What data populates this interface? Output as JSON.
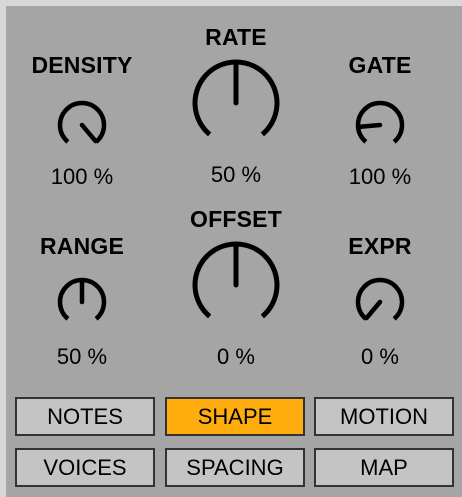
{
  "colors": {
    "panel_background": "#a5a5a5",
    "frame_background": "#d7d7d7",
    "knob_stroke": "#000000",
    "button_background": "#c4c4c4",
    "button_active": "#ffad0e",
    "button_border": "#333333"
  },
  "knobs": [
    {
      "id": "density",
      "label": "DENSITY",
      "value_text": "100 %",
      "position": 1.0
    },
    {
      "id": "rate",
      "label": "RATE",
      "value_text": "50 %",
      "position": 0.5
    },
    {
      "id": "gate",
      "label": "GATE",
      "value_text": "100 %",
      "position": 0.16
    },
    {
      "id": "range",
      "label": "RANGE",
      "value_text": "50 %",
      "position": 0.5
    },
    {
      "id": "offset",
      "label": "OFFSET",
      "value_text": "0 %",
      "position": 0.5
    },
    {
      "id": "expr",
      "label": "EXPR",
      "value_text": "0 %",
      "position": 0.0
    }
  ],
  "buttons": [
    {
      "id": "notes",
      "label": "NOTES",
      "active": false
    },
    {
      "id": "shape",
      "label": "SHAPE",
      "active": true
    },
    {
      "id": "motion",
      "label": "MOTION",
      "active": false
    },
    {
      "id": "voices",
      "label": "VOICES",
      "active": false
    },
    {
      "id": "spacing",
      "label": "SPACING",
      "active": false
    },
    {
      "id": "map",
      "label": "MAP",
      "active": false
    }
  ]
}
